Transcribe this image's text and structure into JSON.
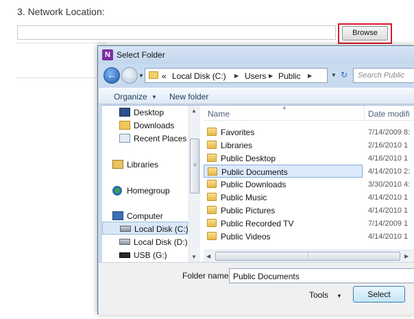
{
  "page": {
    "section_title": "3. Network Location:",
    "path_value": "",
    "browse_label": "Browse"
  },
  "dialog": {
    "title": "Select Folder",
    "app_icon_letter": "N",
    "address": {
      "prefix": "«",
      "segments": [
        "Local Disk (C:)",
        "Users",
        "Public"
      ]
    },
    "search_placeholder": "Search Public",
    "toolbar": {
      "organize": "Organize",
      "new_folder": "New folder"
    },
    "nav_pane": [
      {
        "label": "Desktop",
        "icon": "desktop-icon"
      },
      {
        "label": "Downloads",
        "icon": "downloads-icon"
      },
      {
        "label": "Recent Places",
        "icon": "recent-places-icon"
      },
      {
        "label": "Libraries",
        "icon": "libraries-icon"
      },
      {
        "label": "Homegroup",
        "icon": "homegroup-icon"
      },
      {
        "label": "Computer",
        "icon": "computer-icon"
      },
      {
        "label": "Local Disk (C:)",
        "icon": "drive-icon",
        "selected": true
      },
      {
        "label": "Local Disk (D:)",
        "icon": "drive-icon"
      },
      {
        "label": "USB (G:)",
        "icon": "usb-drive-icon"
      }
    ],
    "columns": {
      "name": "Name",
      "date": "Date modifi"
    },
    "files": [
      {
        "name": "Favorites",
        "date": "7/14/2009 8:"
      },
      {
        "name": "Libraries",
        "date": "2/16/2010 1"
      },
      {
        "name": "Public Desktop",
        "date": "4/16/2010 1"
      },
      {
        "name": "Public Documents",
        "date": "4/14/2010 2:",
        "selected": true
      },
      {
        "name": "Public Downloads",
        "date": "3/30/2010 4:"
      },
      {
        "name": "Public Music",
        "date": "4/14/2010 1"
      },
      {
        "name": "Public Pictures",
        "date": "4/14/2010 1"
      },
      {
        "name": "Public Recorded TV",
        "date": "7/14/2009 1"
      },
      {
        "name": "Public Videos",
        "date": "4/14/2010 1"
      }
    ],
    "folder_name_label": "Folder name:",
    "folder_name_value": "Public Documents",
    "tools_label": "Tools",
    "select_label": "Select"
  },
  "colors": {
    "highlight": "#d8192b",
    "dialog_frame": "#c9dbef",
    "selection": "#dceafb"
  }
}
